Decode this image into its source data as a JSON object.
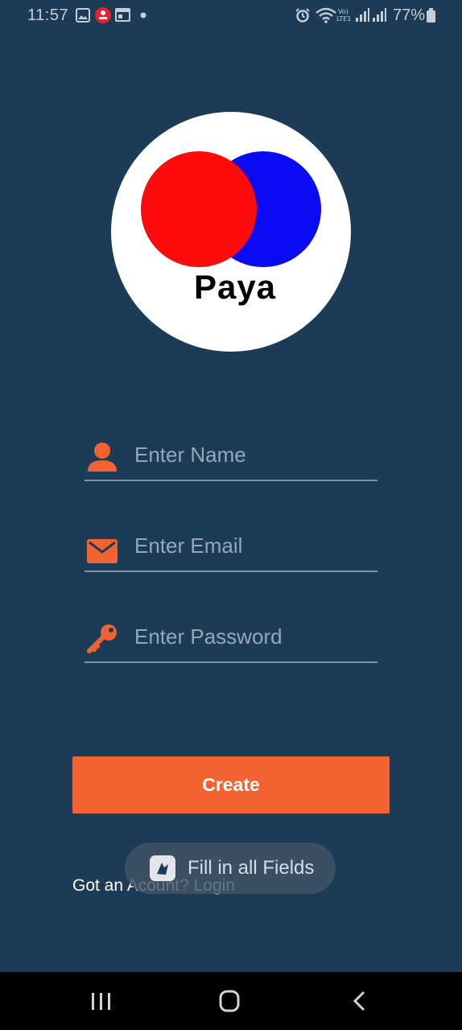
{
  "status_bar": {
    "time": "11:57",
    "battery": "77%",
    "icons": [
      "gallery-icon",
      "app-notification-icon",
      "calendar-icon",
      "dot-icon",
      "alarm-icon",
      "wifi-icon",
      "volte-icon",
      "signal-icon",
      "signal-icon",
      "battery-icon"
    ]
  },
  "logo": {
    "text": "Paya",
    "colors": {
      "red": "#ff0a0a",
      "blue": "#0a0af5",
      "circle": "#ffffff"
    }
  },
  "form": {
    "name_placeholder": "Enter Name",
    "email_placeholder": "Enter Email",
    "password_placeholder": "Enter Password",
    "icons": {
      "name": "person-icon",
      "email": "mail-icon",
      "password": "key-icon"
    }
  },
  "create_button": {
    "label": "Create",
    "color": "#f26331"
  },
  "login_link": {
    "text": "Got an Acount? Login"
  },
  "toast": {
    "text": "Fill in all Fields",
    "icon": "app-icon"
  },
  "nav_bar": {
    "buttons": [
      "recent-apps-icon",
      "home-icon",
      "back-icon"
    ]
  },
  "colors": {
    "background": "#1b3b57",
    "accent": "#f26331"
  }
}
